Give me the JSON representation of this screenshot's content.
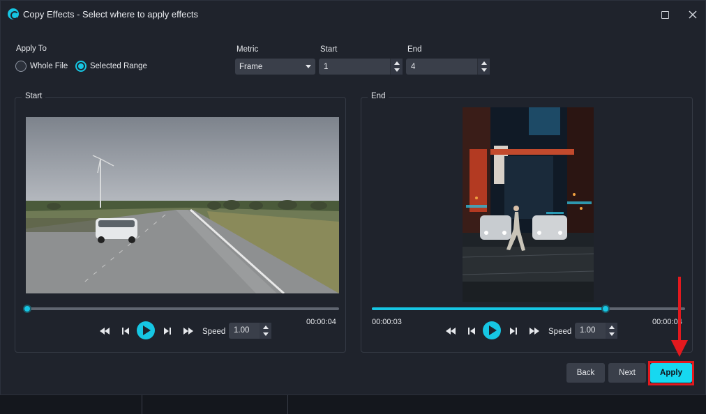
{
  "window": {
    "title": "Copy Effects - Select where to apply effects",
    "maximize_icon": "maximize-icon",
    "close_icon": "close-icon"
  },
  "apply_to": {
    "label": "Apply To",
    "options": [
      "Whole File",
      "Selected Range"
    ],
    "selected": "Selected Range"
  },
  "metric": {
    "label": "Metric",
    "value": "Frame"
  },
  "start": {
    "label": "Start",
    "value": "1"
  },
  "end": {
    "label": "End",
    "value": "4"
  },
  "start_panel": {
    "title": "Start",
    "timestamp": "00:00:04",
    "position_fraction": 0.0,
    "speed_label": "Speed",
    "speed_value": "1.00"
  },
  "end_panel": {
    "title": "End",
    "current_time": "00:00:03",
    "total_time": "00:00:04",
    "position_fraction": 0.75,
    "speed_label": "Speed",
    "speed_value": "1.00"
  },
  "buttons": {
    "back": "Back",
    "next": "Next",
    "apply": "Apply"
  },
  "colors": {
    "accent": "#16c6e3",
    "highlight": "#e3191e",
    "background": "#1f232c"
  }
}
